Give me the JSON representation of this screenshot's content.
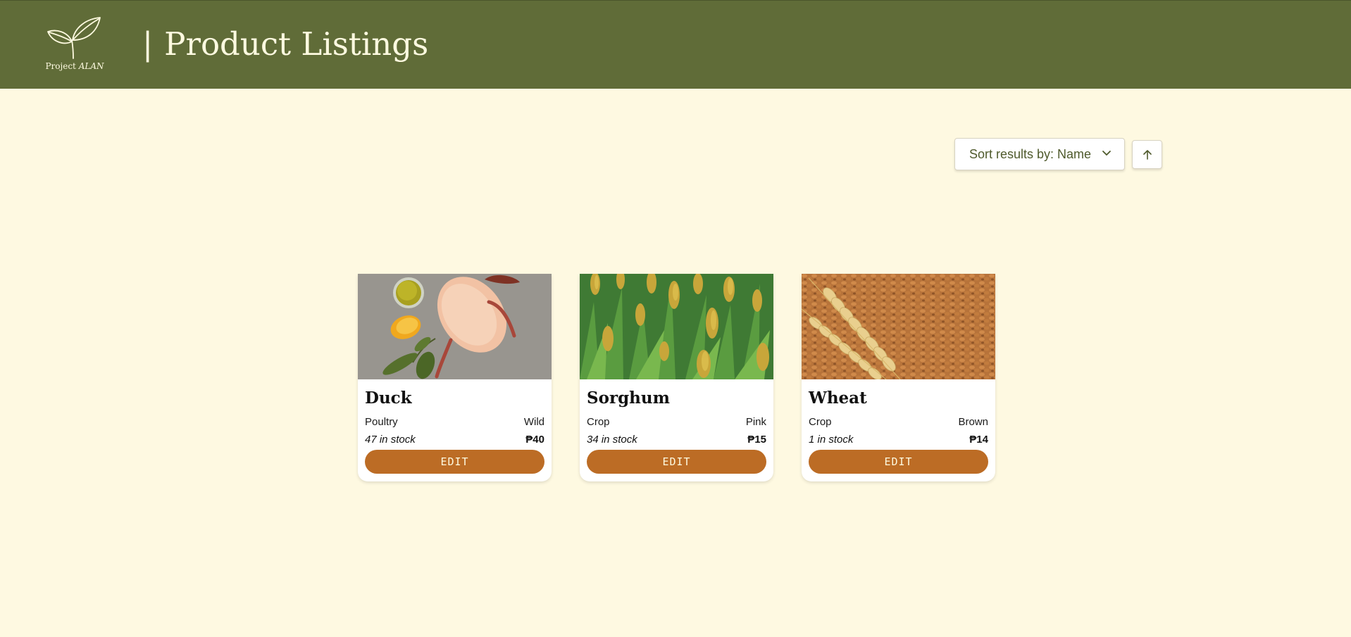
{
  "header": {
    "logo_text_plain": "Project",
    "logo_text_italic": "ALAN",
    "title_bar": "|",
    "title": "Product Listings"
  },
  "toolbar": {
    "sort_label": "Sort results by: Name",
    "sort_direction": "ascending"
  },
  "colors": {
    "header_bg": "#606c38",
    "page_bg": "#fef9e1",
    "accent": "#bc6c25",
    "header_text": "#fefae0"
  },
  "products": [
    {
      "name": "Duck",
      "category": "Poultry",
      "variety": "Wild",
      "stock": "47 in stock",
      "price": "₱40",
      "button": "EDIT",
      "image": "duck-photo"
    },
    {
      "name": "Sorghum",
      "category": "Crop",
      "variety": "Pink",
      "stock": "34 in stock",
      "price": "₱15",
      "button": "EDIT",
      "image": "sorghum-photo"
    },
    {
      "name": "Wheat",
      "category": "Crop",
      "variety": "Brown",
      "stock": "1 in stock",
      "price": "₱14",
      "button": "EDIT",
      "image": "wheat-photo"
    }
  ]
}
